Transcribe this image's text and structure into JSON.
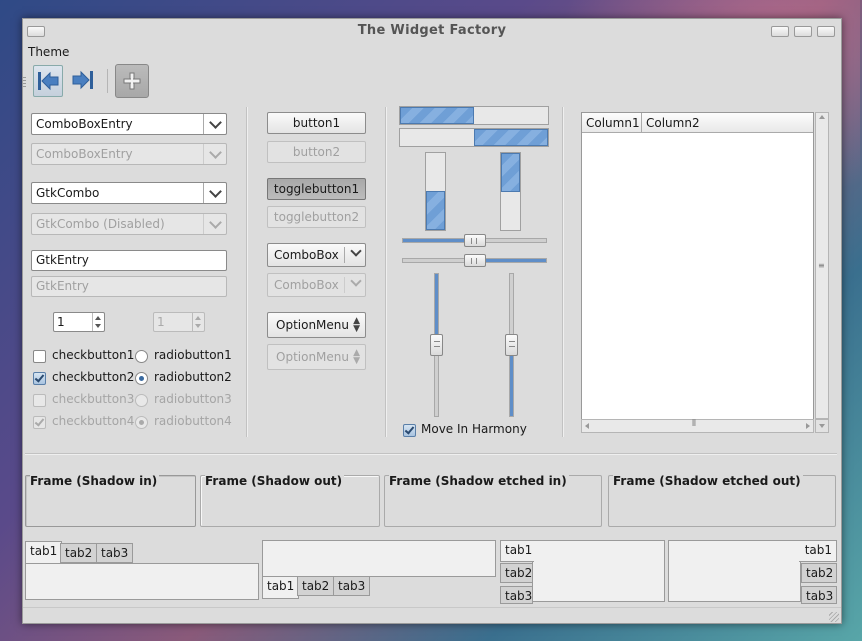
{
  "window": {
    "title": "The Widget Factory"
  },
  "menubar": {
    "theme": "Theme"
  },
  "left": {
    "combo_entry": "ComboBoxEntry",
    "combo_entry_disabled": "ComboBoxEntry",
    "gtk_combo": "GtkCombo",
    "gtk_combo_disabled": "GtkCombo (Disabled)",
    "entry": "GtkEntry",
    "entry_disabled": "GtkEntry",
    "spin_value": "1",
    "spin_disabled_value": "1",
    "checks": [
      {
        "label": "checkbutton1",
        "checked": false,
        "disabled": false
      },
      {
        "label": "checkbutton2",
        "checked": true,
        "disabled": false
      },
      {
        "label": "checkbutton3",
        "checked": false,
        "disabled": true
      },
      {
        "label": "checkbutton4",
        "checked": true,
        "disabled": true
      }
    ],
    "radios": [
      {
        "label": "radiobutton1",
        "selected": false,
        "disabled": false
      },
      {
        "label": "radiobutton2",
        "selected": true,
        "disabled": false
      },
      {
        "label": "radiobutton3",
        "selected": false,
        "disabled": true
      },
      {
        "label": "radiobutton4",
        "selected": true,
        "disabled": true
      }
    ]
  },
  "middle": {
    "button1": "button1",
    "button2": "button2",
    "toggle1": "togglebutton1",
    "toggle2": "togglebutton2",
    "combobox": "ComboBox",
    "combobox_disabled": "ComboBox",
    "optionmenu": "OptionMenu",
    "optionmenu_disabled": "OptionMenu"
  },
  "ranges": {
    "hprogress1_fraction": 0.5,
    "hprogress2_fraction": 0.5,
    "vprogress1_fraction": 0.5,
    "vprogress2_fraction": 0.5,
    "hscale1_fraction": 0.5,
    "hscale2_fraction": 0.5,
    "vscale1_fraction": 0.5,
    "vscale2_fraction": 0.5,
    "move_in_harmony": "Move In Harmony",
    "move_in_harmony_checked": true
  },
  "tree": {
    "columns": [
      "Column1",
      "Column2"
    ]
  },
  "frames": [
    "Frame (Shadow in)",
    "Frame (Shadow out)",
    "Frame (Shadow etched in)",
    "Frame (Shadow etched out)"
  ],
  "notebooks": {
    "tabs": [
      "tab1",
      "tab2",
      "tab3"
    ]
  },
  "colors": {
    "accent": "#5f8ec8",
    "window_bg": "#dcdcdc"
  },
  "icons": [
    "go-first-icon",
    "go-last-icon",
    "add-icon",
    "chevron-down-icon"
  ]
}
